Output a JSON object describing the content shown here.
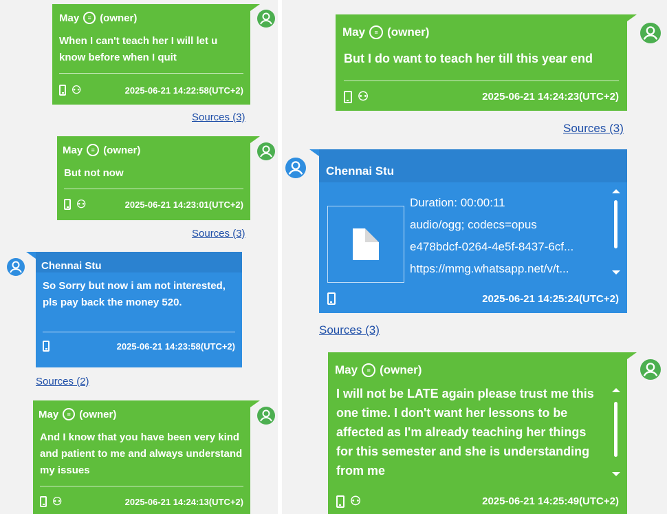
{
  "left_column": {
    "messages": [
      {
        "sender": "May",
        "role": "(owner)",
        "text": "When I can't teach her I will let u know before when I quit",
        "timestamp": "2025-06-21 14:22:58(UTC+2)",
        "sources": "Sources (3)"
      },
      {
        "sender": "May",
        "role": "(owner)",
        "text": "But not now",
        "timestamp": "2025-06-21 14:23:01(UTC+2)",
        "sources": "Sources (3)"
      },
      {
        "sender": "Chennai Stu",
        "text": "So Sorry but now i am not interested, pls pay back the money 520.",
        "timestamp": "2025-06-21 14:23:58(UTC+2)",
        "sources": "Sources (2)"
      },
      {
        "sender": "May",
        "role": "(owner)",
        "text": "And I know that you have been very kind and patient to me and always understand my issues",
        "timestamp": "2025-06-21 14:24:13(UTC+2)"
      }
    ]
  },
  "right_column": {
    "messages": [
      {
        "sender": "May",
        "role": "(owner)",
        "text": "But I do want to teach her till this year end",
        "timestamp": "2025-06-21 14:24:23(UTC+2)",
        "sources": "Sources (3)"
      },
      {
        "sender": "Chennai Stu",
        "attachment": {
          "duration": "Duration: 00:00:11",
          "mime": "audio/ogg; codecs=opus",
          "id": "e478bdcf-0264-4e5f-8437-6cf...",
          "url": "https://mmg.whatsapp.net/v/t..."
        },
        "timestamp": "2025-06-21 14:25:24(UTC+2)",
        "sources": "Sources (3)"
      },
      {
        "sender": "May",
        "role": "(owner)",
        "text": "I will not be LATE again please trust me this one time. I don't want her lessons to be affected as I'm already teaching her things for this semester and she is understanding from me",
        "timestamp": "2025-06-21 14:25:49(UTC+2)"
      }
    ]
  },
  "icons": {
    "phone": "phone-icon",
    "group": "group-icon",
    "avatar": "user-avatar-icon",
    "emoji": "emoji-icon",
    "file": "file-icon"
  },
  "colors": {
    "owner_bubble": "#5fbe3c",
    "contact_bubble": "#2f8ee0",
    "link": "#1f4fa8"
  }
}
